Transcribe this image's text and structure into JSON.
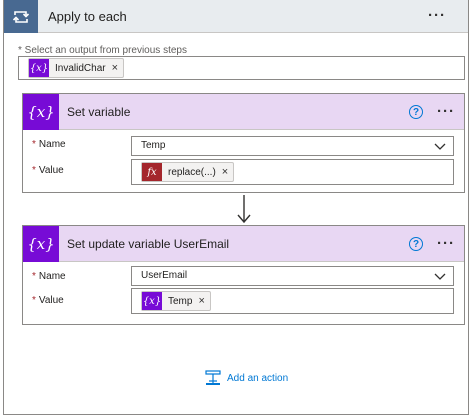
{
  "loop": {
    "title": "Apply to each",
    "select_label": "* Select an output from previous steps",
    "token": {
      "label": "InvalidChar",
      "icon": "variable-icon",
      "icon_glyph": "{x}"
    },
    "menu_glyph": "···"
  },
  "cards": [
    {
      "title": "Set variable",
      "badge_glyph": "{x}",
      "help_glyph": "?",
      "menu_glyph": "···",
      "name_label": "Name",
      "name_value": "Temp",
      "value_label": "Value",
      "value_token": {
        "label": "replace(...)",
        "icon_glyph": "fx"
      }
    },
    {
      "title": "Set update variable UserEmail",
      "badge_glyph": "{x}",
      "help_glyph": "?",
      "menu_glyph": "···",
      "name_label": "Name",
      "name_value": "UserEmail",
      "value_label": "Value",
      "value_token": {
        "label": "Temp",
        "icon_glyph": "{x}"
      }
    }
  ],
  "required_mark": "*",
  "remove_glyph": "×",
  "add_action_label": "Add an action",
  "colors": {
    "loop_header": "#486991",
    "variable_purple": "#770bd6",
    "card_header": "#e8d7f3",
    "expression_red": "#a4262c",
    "link_blue": "#0078d4"
  }
}
